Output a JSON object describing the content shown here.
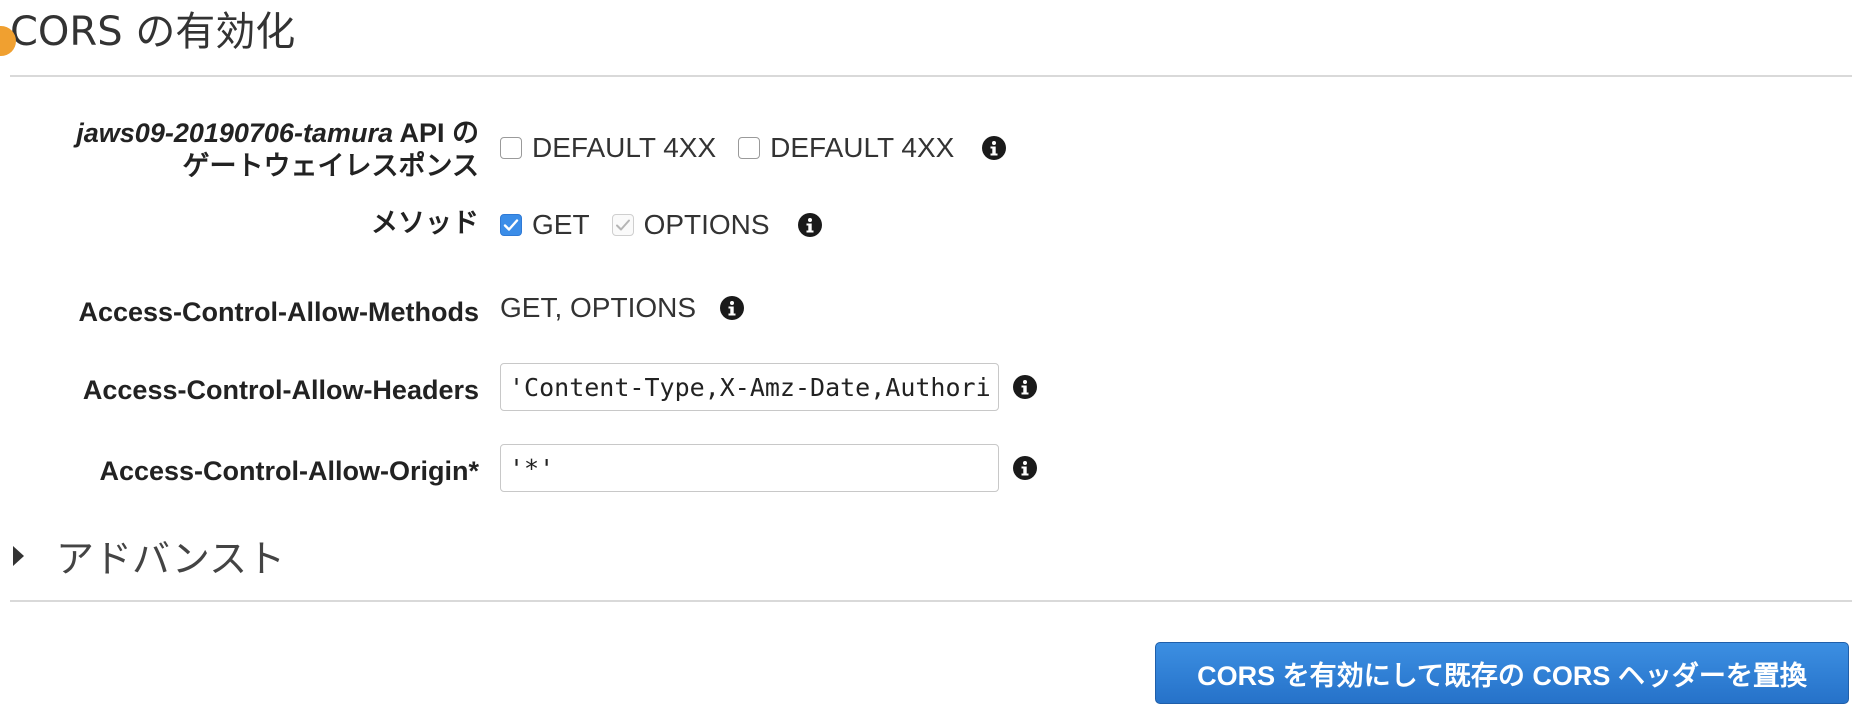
{
  "page": {
    "title": "CORS の有効化"
  },
  "gateway_responses": {
    "label_project": "jaws09-20190706-tamura",
    "label_suffix": " API の",
    "label_line2": "ゲートウェイレスポンス",
    "options": [
      {
        "label": "DEFAULT 4XX",
        "checked": false
      },
      {
        "label": "DEFAULT 4XX",
        "checked": false
      }
    ]
  },
  "methods": {
    "label": "メソッド",
    "options": [
      {
        "label": "GET",
        "checked": true
      },
      {
        "label": "OPTIONS",
        "checked": true,
        "disabled": true
      }
    ]
  },
  "allow_methods": {
    "label": "Access-Control-Allow-Methods",
    "value": "GET, OPTIONS"
  },
  "allow_headers": {
    "label": "Access-Control-Allow-Headers",
    "value": "'Content-Type,X-Amz-Date,Authorizat"
  },
  "allow_origin": {
    "label": "Access-Control-Allow-Origin*",
    "value": "'*'"
  },
  "advanced": {
    "label": "アドバンスト"
  },
  "submit_button": {
    "label": "CORS を有効にして既存の CORS ヘッダーを置換"
  },
  "colors": {
    "accent": "#2f7ad6",
    "button": "#2b77cf",
    "divider": "#d9d9d9"
  },
  "icons": [
    "info-icon",
    "checkmark-icon",
    "caret-right-icon"
  ]
}
